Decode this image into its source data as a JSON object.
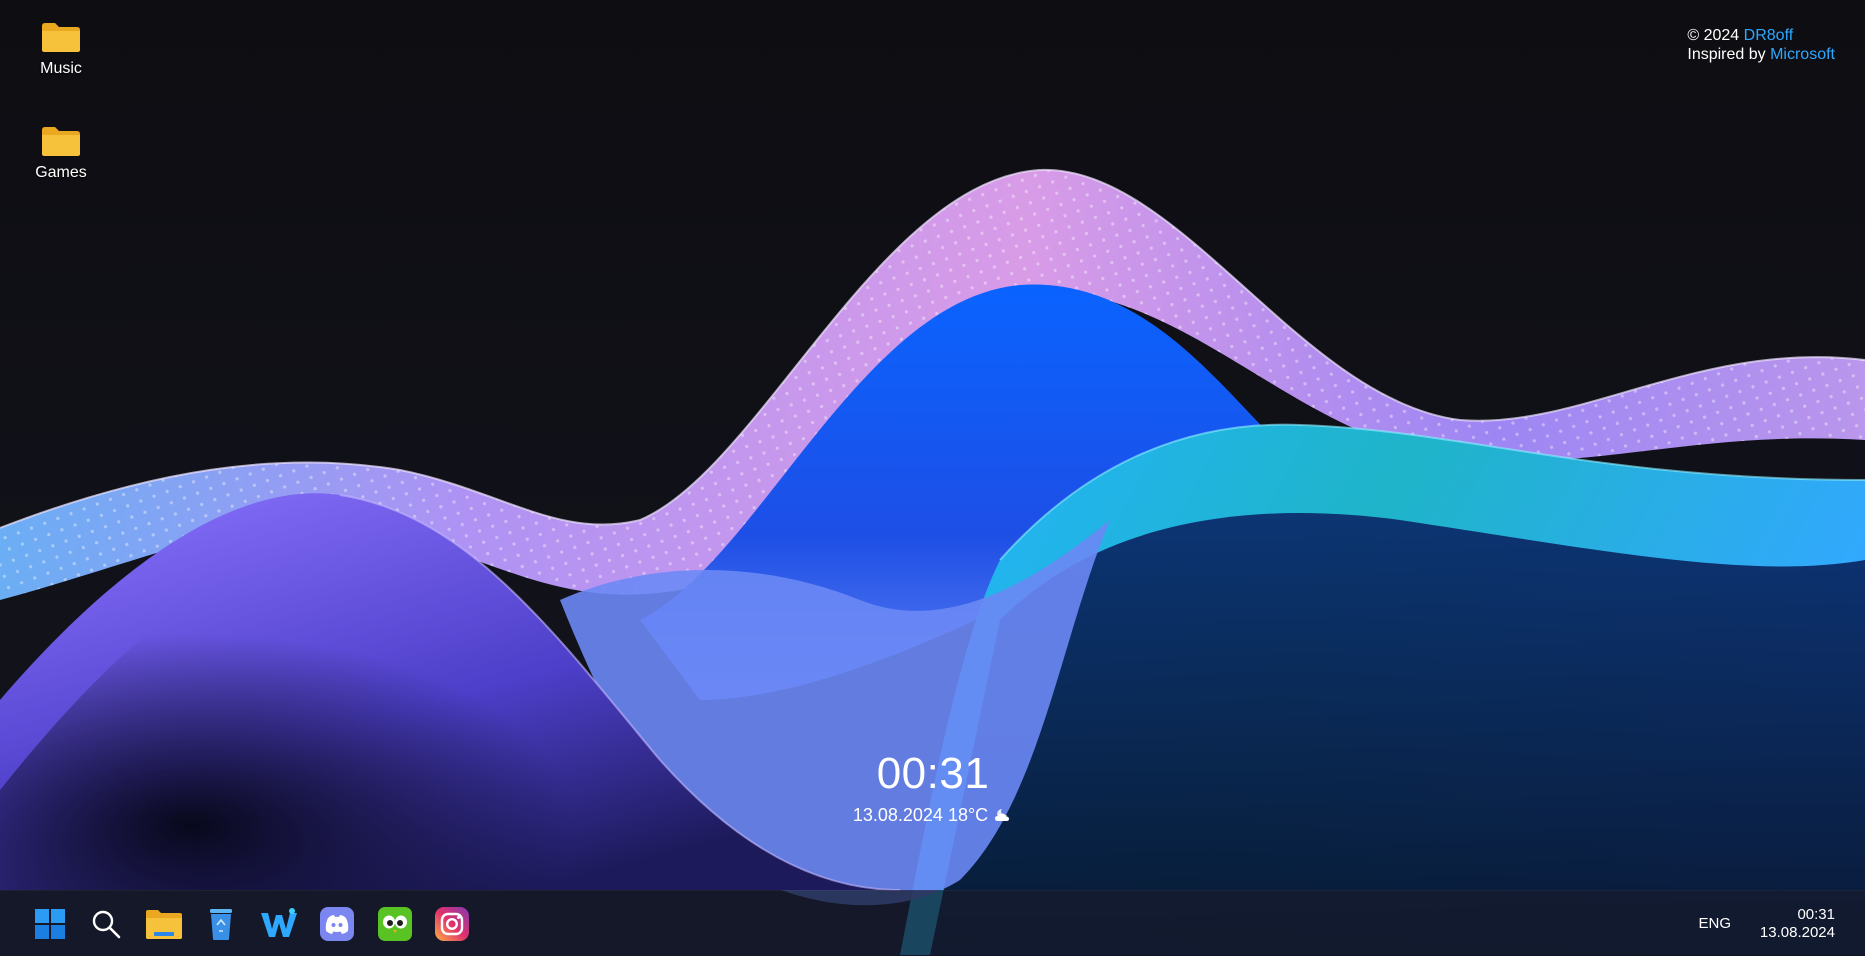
{
  "desktop": {
    "icons": [
      {
        "label": "Music",
        "icon": "folder-icon"
      },
      {
        "label": "Games",
        "icon": "folder-icon"
      }
    ]
  },
  "credits": {
    "line1_prefix": "© 2024 ",
    "line1_link": "DR8off",
    "line2_prefix": "Inspired by ",
    "line2_link": "Microsoft",
    "link_color": "#2ea8ff"
  },
  "widget": {
    "time": "00:31",
    "date": "13.08.2024",
    "temperature": "18°C",
    "weather_icon": "partly-cloudy-night-icon"
  },
  "taskbar": {
    "apps": [
      {
        "name": "start",
        "icon": "windows-logo-icon"
      },
      {
        "name": "search",
        "icon": "search-icon"
      },
      {
        "name": "file-explorer",
        "icon": "folder-icon"
      },
      {
        "name": "recycle-bin",
        "icon": "recycle-bin-icon"
      },
      {
        "name": "w-app",
        "icon": "w-app-icon"
      },
      {
        "name": "discord",
        "icon": "discord-icon"
      },
      {
        "name": "duolingo",
        "icon": "duolingo-owl-icon"
      },
      {
        "name": "instagram",
        "icon": "instagram-icon"
      }
    ],
    "language": "ENG",
    "time": "00:31",
    "date": "13.08.2024"
  },
  "colors": {
    "background": "#0d0d14",
    "taskbar": "#161a2c",
    "folder": "#f5b92e",
    "accent_blue": "#2ea8ff"
  }
}
